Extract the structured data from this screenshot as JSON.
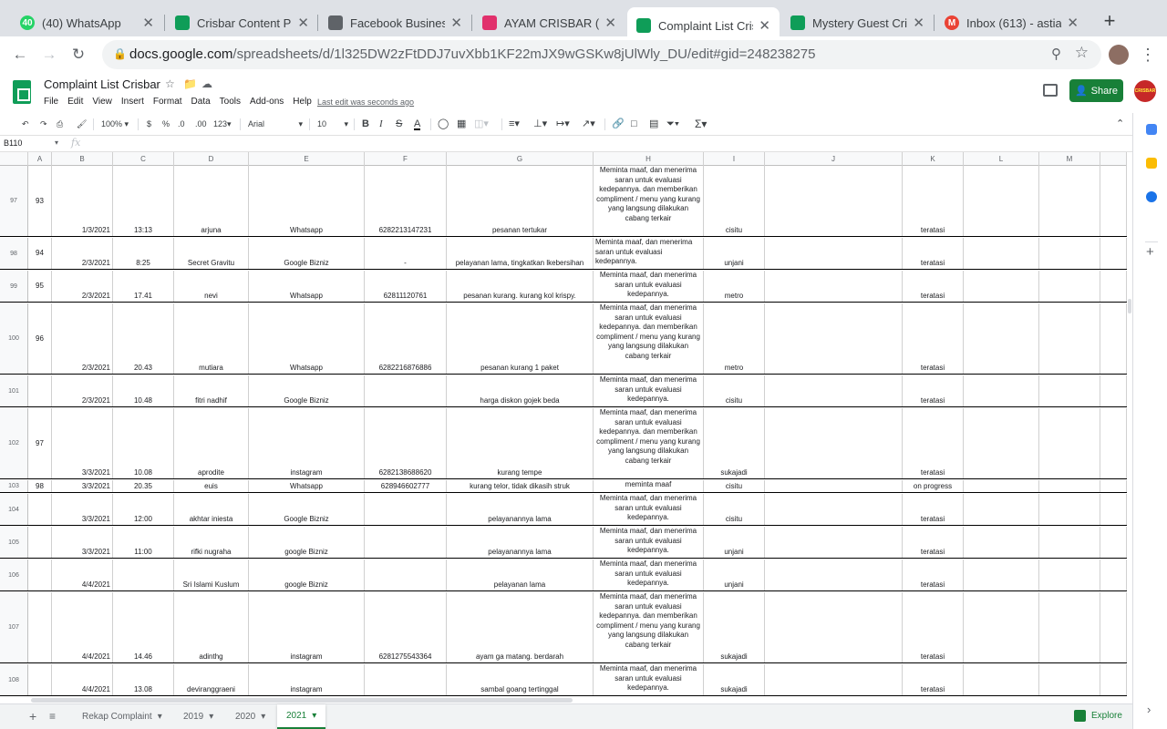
{
  "tabs": [
    {
      "title": "(40) WhatsApp",
      "fav": "40",
      "color": "#25d366"
    },
    {
      "title": "Crisbar Content Pl",
      "fav": "",
      "color": "#0f9d58"
    },
    {
      "title": "Facebook Busines",
      "fav": "",
      "color": "#5f6368"
    },
    {
      "title": "AYAM CRISBAR (@",
      "fav": "",
      "color": "#e1306c"
    },
    {
      "title": "Complaint List Cris",
      "fav": "",
      "color": "#0f9d58"
    },
    {
      "title": "Mystery Guest Cri",
      "fav": "",
      "color": "#0f9d58"
    },
    {
      "title": "Inbox (613) - astia",
      "fav": "M",
      "color": "#ea4335"
    }
  ],
  "url": {
    "host": "docs.google.com",
    "path": "/spreadsheets/d/1l325DW2zFtDDJ7uvXbb1KF22mJX9wGSKw8jUlWly_DU/edit#gid=248238275"
  },
  "doc": {
    "title": "Complaint List Crisbar",
    "menus": [
      "File",
      "Edit",
      "View",
      "Insert",
      "Format",
      "Data",
      "Tools",
      "Add-ons",
      "Help"
    ],
    "last_edit": "Last edit was seconds ago",
    "share_label": "Share",
    "brand_logo_text": "CRISBAR"
  },
  "toolbar": {
    "zoom": "100%",
    "currency": "$",
    "percent": "%",
    "dec_less": ".0",
    "dec_more": ".00",
    "format": "123",
    "font": "Arial",
    "size": "10"
  },
  "namebox": "B110",
  "fx": "fx",
  "columns": [
    "A",
    "B",
    "C",
    "D",
    "E",
    "F",
    "G",
    "H",
    "I",
    "J",
    "K",
    "L",
    "M"
  ],
  "rows": [
    {
      "n": "97",
      "a": "93",
      "b": "1/3/2021",
      "c": "13:13",
      "d": "arjuna",
      "e": "Whatsapp",
      "f": "6282213147231",
      "g": "pesanan tertukar",
      "h": "Meminta maaf, dan menerima saran untuk evaluasi kedepannya. dan memberikan compliment / menu yang kurang yang langsung dilakukan cabang terkair",
      "i": "cisitu",
      "k": "teratasi"
    },
    {
      "n": "98",
      "a": "94",
      "b": "2/3/2021",
      "c": "8:25",
      "d": "Secret Gravitu",
      "e": "Google Bizniz",
      "f": "-",
      "g": "pelayanan lama, tingkatkan lkebersihan",
      "h": "Meminta maaf, dan menerima saran untuk evaluasi kedepannya.",
      "i": "unjani",
      "k": "teratasi"
    },
    {
      "n": "99",
      "a": "95",
      "b": "2/3/2021",
      "c": "17.41",
      "d": "nevi",
      "e": "Whatsapp",
      "f": "62811120761",
      "g": "pesanan kurang. kurang kol krispy.",
      "h": "Meminta maaf, dan menerima saran untuk evaluasi kedepannya.",
      "i": "metro",
      "k": "teratasi"
    },
    {
      "n": "100",
      "a": "96",
      "b": "2/3/2021",
      "c": "20.43",
      "d": "mutiara",
      "e": "Whatsapp",
      "f": "6282216876886",
      "g": "pesanan kurang 1 paket",
      "h": "Meminta maaf, dan menerima saran untuk evaluasi kedepannya. dan memberikan compliment / menu yang kurang yang langsung dilakukan cabang terkair",
      "i": "metro",
      "k": "teratasi"
    },
    {
      "n": "101",
      "a": "",
      "b": "2/3/2021",
      "c": "10.48",
      "d": "fitri nadhif",
      "e": "Google Bizniz",
      "f": "",
      "g": "harga diskon gojek beda",
      "h": "Meminta maaf, dan menerima saran untuk evaluasi kedepannya.",
      "i": "cisitu",
      "k": "teratasi"
    },
    {
      "n": "102",
      "a": "97",
      "b": "3/3/2021",
      "c": "10.08",
      "d": "aprodite",
      "e": "instagram",
      "f": "6282138688620",
      "g": "kurang tempe",
      "h": "Meminta maaf, dan menerima saran untuk evaluasi kedepannya. dan memberikan compliment / menu yang kurang yang langsung dilakukan cabang terkair",
      "i": "sukajadi",
      "k": "teratasi"
    },
    {
      "n": "103",
      "a": "98",
      "b": "3/3/2021",
      "c": "20.35",
      "d": "euis",
      "e": "Whatsapp",
      "f": "628946602777",
      "g": "kurang telor, tidak dikasih struk",
      "h": "meminta maaf",
      "i": "cisitu",
      "k": "on progress"
    },
    {
      "n": "104",
      "a": "",
      "b": "3/3/2021",
      "c": "12:00",
      "d": "akhtar iniesta",
      "e": "Google Bizniz",
      "f": "",
      "g": "pelayanannya lama",
      "h": "Meminta maaf, dan menerima saran untuk evaluasi kedepannya.",
      "i": "cisitu",
      "k": "teratasi"
    },
    {
      "n": "105",
      "a": "",
      "b": "3/3/2021",
      "c": "11:00",
      "d": "rifki nugraha",
      "e": "google Bizniz",
      "f": "",
      "g": "pelayanannya lama",
      "h": "Meminta maaf, dan menerima saran untuk evaluasi kedepannya.",
      "i": "unjani",
      "k": "teratasi"
    },
    {
      "n": "106",
      "a": "",
      "b": "4/4/2021",
      "c": "",
      "d": "Sri Islami Kuslum",
      "e": "google Bizniz",
      "f": "",
      "g": "pelayanan lama",
      "h": "Meminta maaf, dan menerima saran untuk evaluasi kedepannya.",
      "i": "unjani",
      "k": "teratasi"
    },
    {
      "n": "107",
      "a": "",
      "b": "4/4/2021",
      "c": "14.46",
      "d": "adinthg",
      "e": "instagram",
      "f": "6281275543364",
      "g": "ayam ga matang. berdarah",
      "h": "Meminta maaf, dan menerima saran untuk evaluasi kedepannya. dan memberikan compliment / menu yang kurang yang langsung dilakukan cabang terkair",
      "i": "sukajadi",
      "k": "teratasi"
    },
    {
      "n": "108",
      "a": "",
      "b": "4/4/2021",
      "c": "13.08",
      "d": "deviranggraeni",
      "e": "instagram",
      "f": "",
      "g": "sambal goang tertinggal",
      "h": "Meminta maaf, dan menerima saran untuk evaluasi kedepannya.",
      "i": "sukajadi",
      "k": "teratasi"
    },
    {
      "n": "",
      "a": "",
      "b": "",
      "c": "",
      "d": "",
      "e": "",
      "f": "",
      "g": "",
      "h": "Meminta maaf, dan",
      "i": "",
      "k": ""
    }
  ],
  "sheet_tabs": [
    "Rekap Complaint",
    "2019",
    "2020",
    "2021"
  ],
  "active_sheet": "2021",
  "explore_label": "Explore"
}
